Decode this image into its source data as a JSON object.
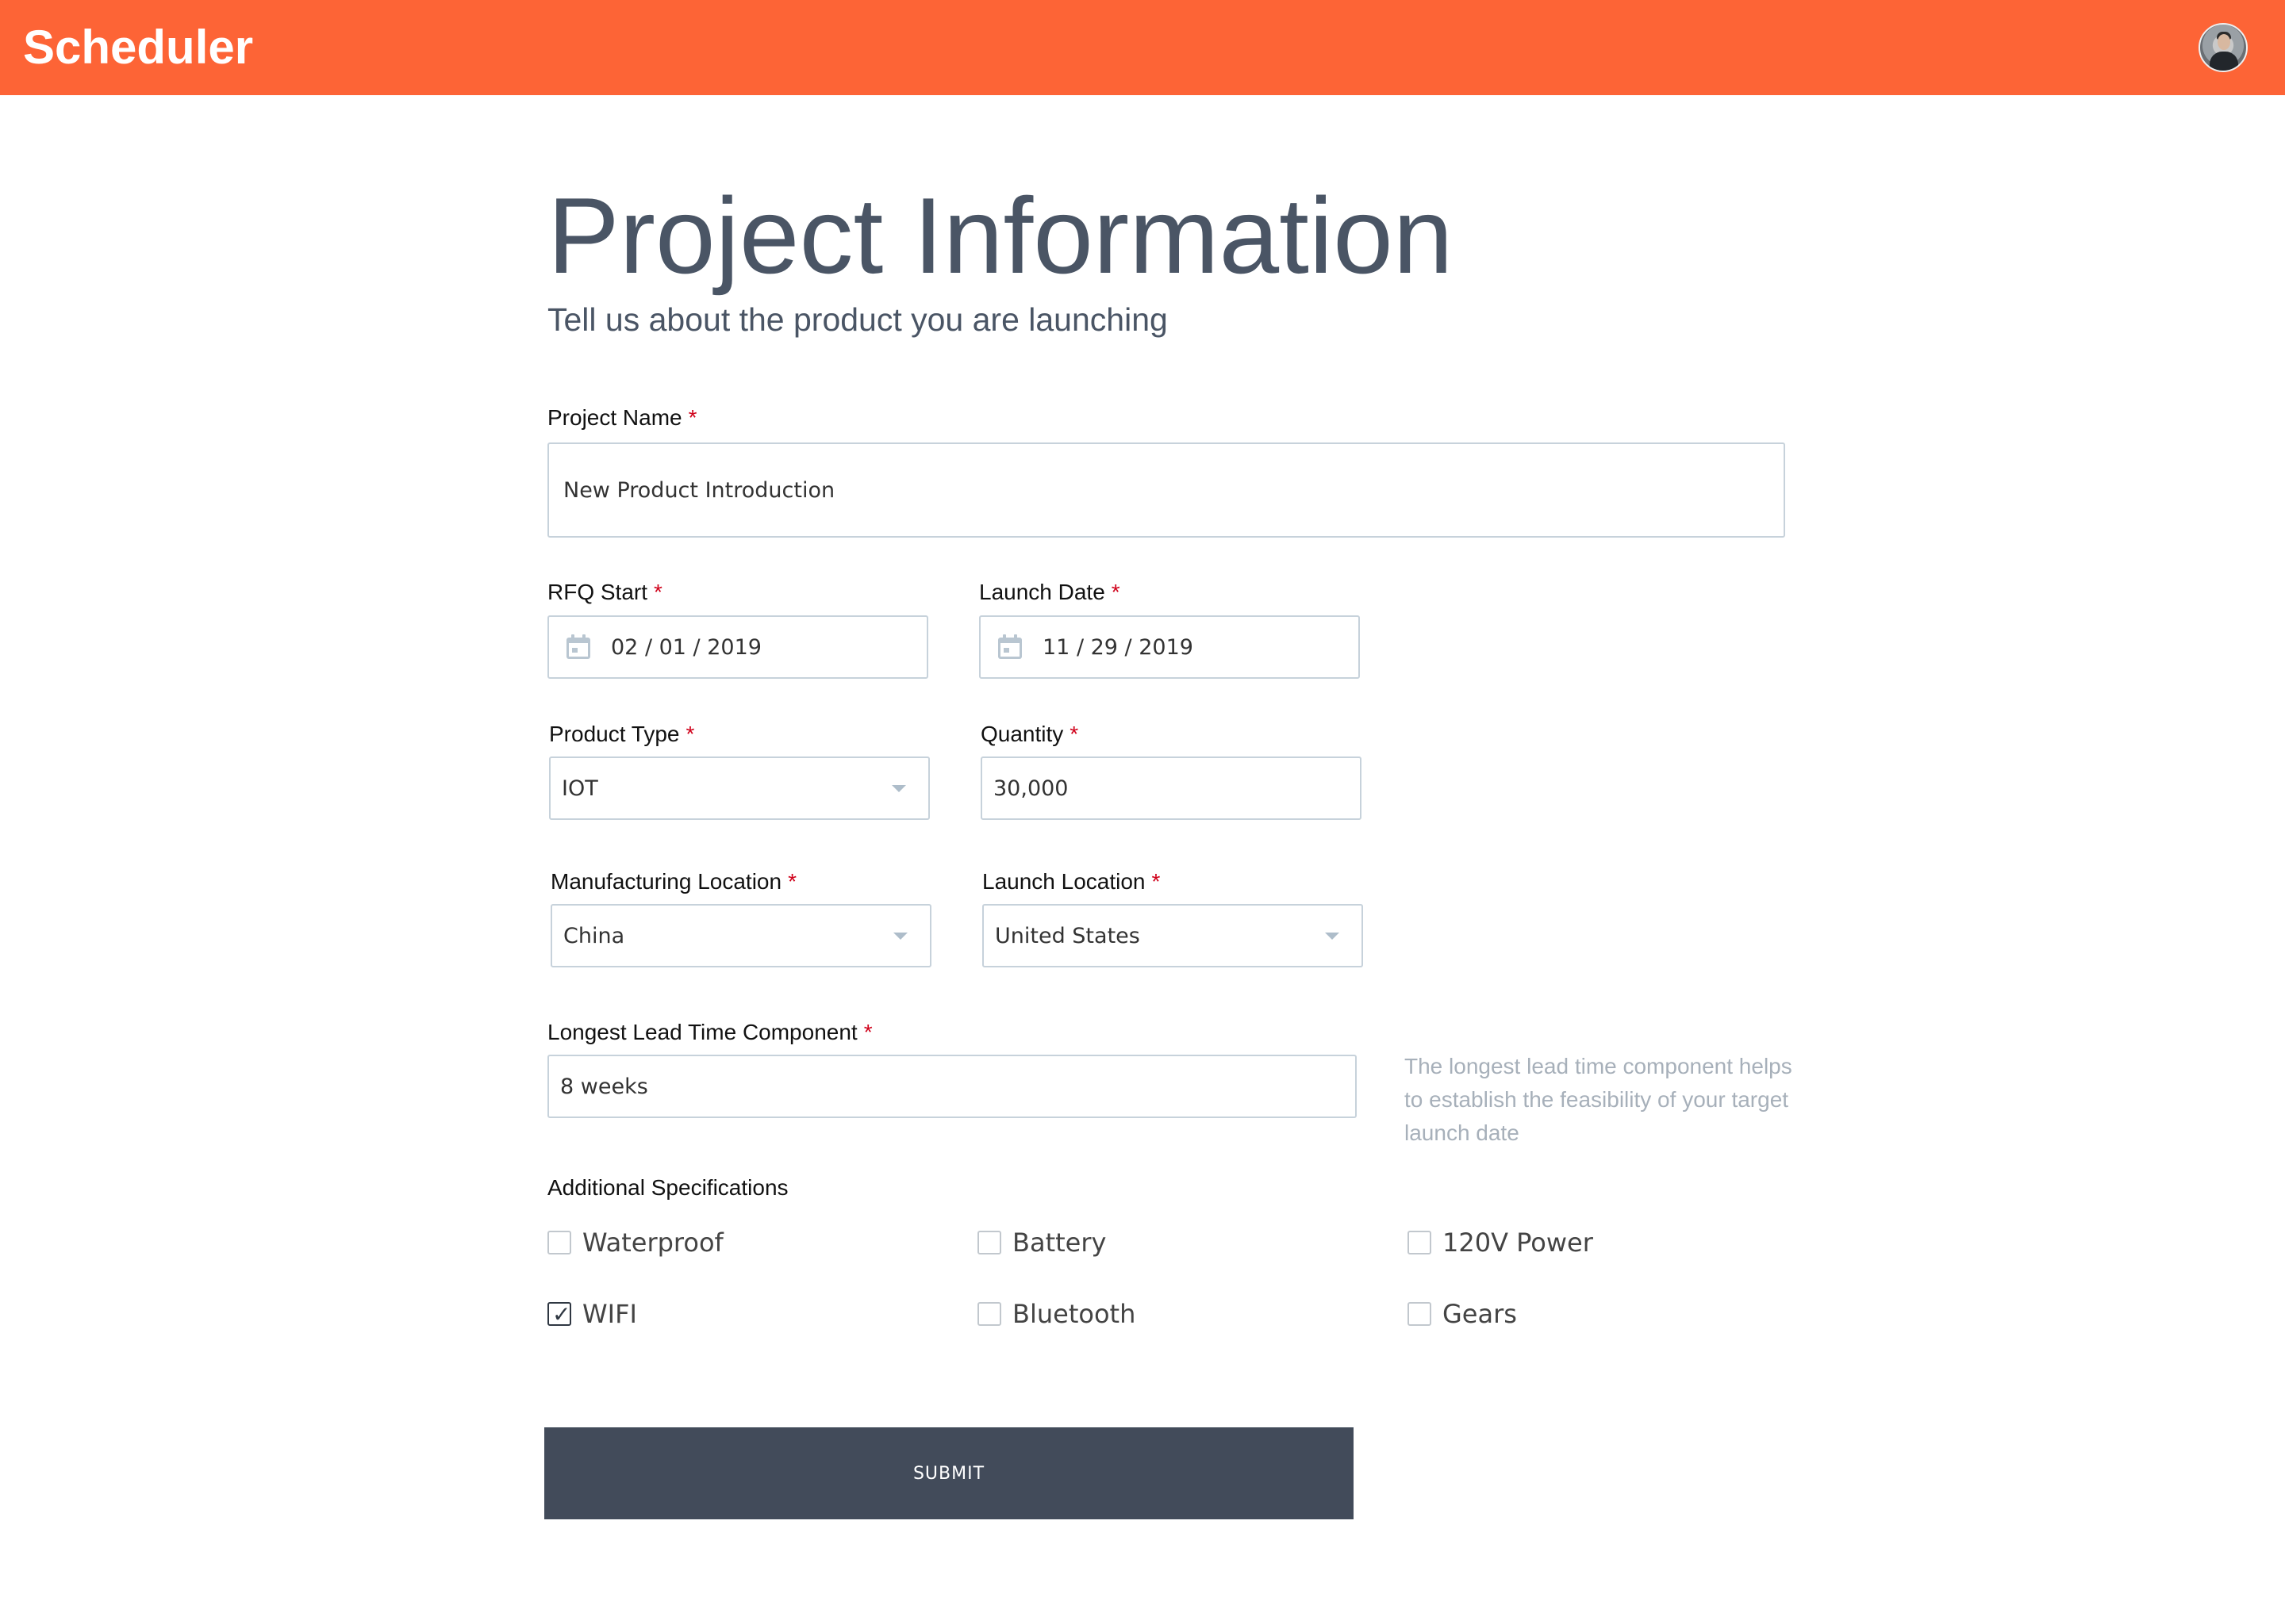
{
  "app": {
    "title": "Scheduler"
  },
  "header": {
    "title": "Project Information",
    "subtitle": "Tell us about the product you are launching"
  },
  "form": {
    "required_marker": "*",
    "project_name": {
      "label": "Project Name",
      "value": "New Product Introduction"
    },
    "rfq_start": {
      "label": "RFQ Start",
      "value": "02 / 01 / 2019"
    },
    "launch_date": {
      "label": "Launch Date",
      "value": "11 / 29 / 2019"
    },
    "product_type": {
      "label": "Product Type",
      "value": "IOT"
    },
    "quantity": {
      "label": "Quantity",
      "value": "30,000"
    },
    "manufacturing_location": {
      "label": "Manufacturing Location",
      "value": "China"
    },
    "launch_location": {
      "label": "Launch Location",
      "value": "United States"
    },
    "lead_time": {
      "label": "Longest Lead Time Component",
      "value": "8 weeks",
      "help": "The longest lead time component helps to establish the feasibility of your target launch date"
    },
    "additional_specs": {
      "label": "Additional Specifications",
      "options": [
        {
          "label": "Waterproof",
          "checked": false
        },
        {
          "label": "Battery",
          "checked": false
        },
        {
          "label": "120V Power",
          "checked": false
        },
        {
          "label": "WIFI",
          "checked": true
        },
        {
          "label": "Bluetooth",
          "checked": false
        },
        {
          "label": "Gears",
          "checked": false
        }
      ]
    },
    "submit_label": "SUBMIT"
  },
  "icons": {
    "calendar": "calendar-icon",
    "dropdown": "chevron-down-icon",
    "checkmark": "✓"
  },
  "colors": {
    "brand": "#fd6436",
    "heading": "#4a5565",
    "required": "#d0021b",
    "button": "#424b5a",
    "field_border": "#c7d2db"
  }
}
